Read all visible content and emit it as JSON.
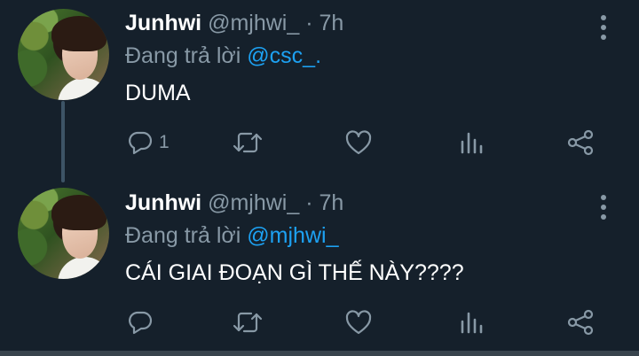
{
  "thread": {
    "tweets": [
      {
        "display_name": "Junhwi",
        "handle": "@mjhwi_",
        "separator": "·",
        "time": "7h",
        "reply_prefix": "Đang trả lời",
        "reply_to": "@csc_.",
        "text": "DUMA",
        "reply_count": "1",
        "icons": [
          "reply-icon",
          "retweet-icon",
          "like-icon",
          "stats-icon",
          "share-icon",
          "more-icon"
        ]
      },
      {
        "display_name": "Junhwi",
        "handle": "@mjhwi_",
        "separator": "·",
        "time": "7h",
        "reply_prefix": "Đang trả lời",
        "reply_to": "@mjhwi_",
        "text": "CÁI GIAI ĐOẠN GÌ THẾ NÀY????",
        "reply_count": "",
        "icons": [
          "reply-icon",
          "retweet-icon",
          "like-icon",
          "stats-icon",
          "share-icon",
          "more-icon"
        ]
      }
    ]
  },
  "colors": {
    "background": "#15202b",
    "primary_text": "#ffffff",
    "secondary_text": "#8899a6",
    "mention": "#1da1f2",
    "thread_line": "#3d5466"
  }
}
